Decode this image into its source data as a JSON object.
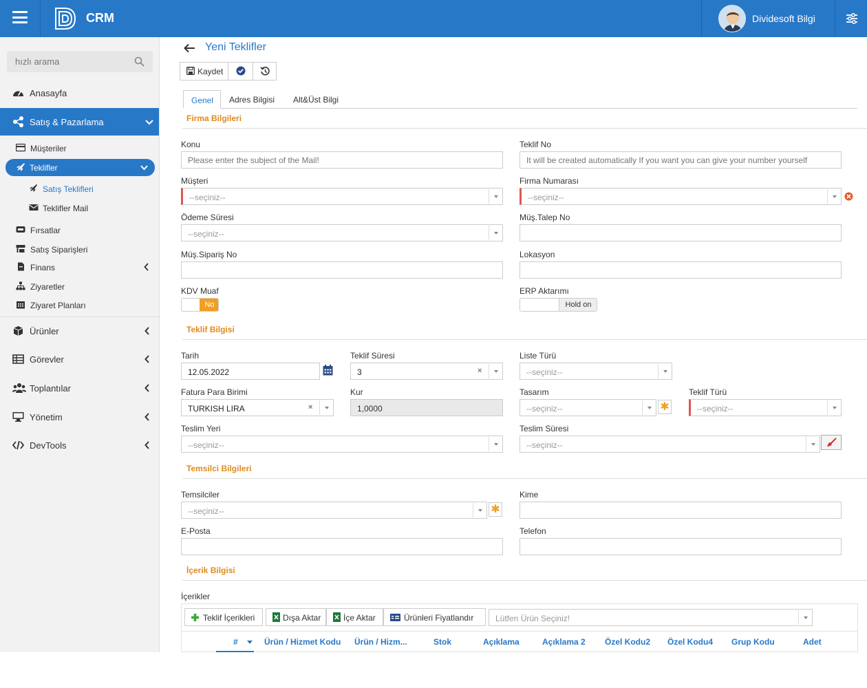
{
  "header": {
    "app_title": "CRM",
    "user_name": "Dividesoft Bilgi"
  },
  "sidebar": {
    "search_placeholder": "hızlı arama",
    "items": [
      {
        "label": "Anasayfa"
      },
      {
        "label": "Satış & Pazarlama"
      },
      {
        "label": "Ürünler"
      },
      {
        "label": "Görevler"
      },
      {
        "label": "Toplantılar"
      },
      {
        "label": "Yönetim"
      },
      {
        "label": "DevTools"
      }
    ],
    "subitems": [
      {
        "label": "Müşteriler"
      },
      {
        "label": "Teklifler"
      },
      {
        "label": "Satış Teklifleri"
      },
      {
        "label": "Teklifler Mail"
      },
      {
        "label": "Fırsatlar"
      },
      {
        "label": "Satış Siparişleri"
      },
      {
        "label": "Finans"
      },
      {
        "label": "Ziyaretler"
      },
      {
        "label": "Ziyaret Planları"
      }
    ]
  },
  "page": {
    "title": "Yeni Teklifler",
    "save_label": "Kaydet"
  },
  "tabs": [
    "Genel",
    "Adres Bilgisi",
    "Alt&Üst Bilgi"
  ],
  "sections": {
    "firma": "Firma Bilgileri",
    "teklif": "Teklif Bilgisi",
    "temsilci": "Temsilci Bilgileri",
    "icerik": "İçerik Bilgisi"
  },
  "fields": {
    "konu": {
      "label": "Konu",
      "placeholder": "Please enter the subject of the Mail!"
    },
    "teklif_no": {
      "label": "Teklif No",
      "placeholder": "It will be created automatically If you want you can give your number yourself"
    },
    "musteri": {
      "label": "Müşteri",
      "value": "--seçiniz--"
    },
    "firma_no": {
      "label": "Firma Numarası",
      "value": "--seçiniz--"
    },
    "odeme": {
      "label": "Ödeme Süresi",
      "value": "--seçiniz--"
    },
    "talep_no": {
      "label": "Müş.Talep No"
    },
    "siparis_no": {
      "label": "Müş.Sipariş No"
    },
    "lokasyon": {
      "label": "Lokasyon"
    },
    "kdv": {
      "label": "KDV Muaf",
      "toggle": "No"
    },
    "erp": {
      "label": "ERP Aktarımı",
      "toggle": "Hold on"
    },
    "tarih": {
      "label": "Tarih",
      "value": "12.05.2022"
    },
    "teklif_suresi": {
      "label": "Teklif Süresi",
      "value": "3"
    },
    "liste_turu": {
      "label": "Liste Türü",
      "value": "--seçiniz--"
    },
    "fatura": {
      "label": "Fatura Para Birimi",
      "value": "TURKISH LIRA"
    },
    "kur": {
      "label": "Kur",
      "value": "1,0000"
    },
    "tasarim": {
      "label": "Tasarım",
      "value": "--seçiniz--"
    },
    "teklif_turu": {
      "label": "Teklif Türü",
      "value": "--seçiniz--"
    },
    "teslim_yeri": {
      "label": "Teslim Yeri",
      "value": "--seçiniz--"
    },
    "teslim_suresi": {
      "label": "Teslim Süresi",
      "value": "--seçiniz--"
    },
    "temsilciler": {
      "label": "Temsilciler",
      "value": "--seçiniz--"
    },
    "kime": {
      "label": "Kime"
    },
    "eposta": {
      "label": "E-Posta"
    },
    "telefon": {
      "label": "Telefon"
    },
    "icerikler": {
      "label": "İçerikler"
    }
  },
  "content_toolbar": {
    "teklif_icerikleri": "Teklif İçerikleri",
    "disa_aktar": "Dışa Aktar",
    "ice_aktar": "İçe Aktar",
    "fiyatlandir": "Ürünleri Fiyatlandır",
    "urun_placeholder": "Lütfen Ürün Seçiniz!"
  },
  "grid_columns": [
    "#",
    "Ürün / Hizmet Kodu",
    "Ürün / Hizm...",
    "Stok",
    "Açıklama",
    "Açıklama 2",
    "Özel Kodu2",
    "Özel Kodu4",
    "Grup Kodu",
    "Adet"
  ],
  "colors": {
    "primary": "#2878c8",
    "accent": "#e08a1e",
    "required": "#e05555"
  }
}
